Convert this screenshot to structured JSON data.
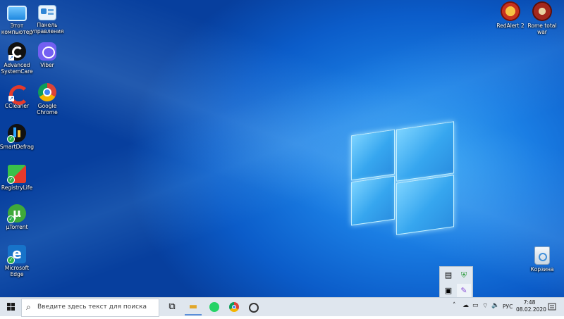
{
  "desktop": {
    "icons_left": [
      {
        "name": "this-pc",
        "label": "Этот\nкомпьютер",
        "icon": "monitor-icon"
      },
      {
        "name": "control-panel",
        "label": "Панель\nуправления",
        "icon": "control-panel-icon"
      },
      {
        "name": "advanced-systemcare",
        "label": "Advanced\nSystemCare",
        "icon": "systemcare-icon"
      },
      {
        "name": "viber",
        "label": "Viber",
        "icon": "viber-icon"
      },
      {
        "name": "ccleaner",
        "label": "CCleaner",
        "icon": "ccleaner-icon"
      },
      {
        "name": "google-chrome",
        "label": "Google\nChrome",
        "icon": "chrome-icon"
      },
      {
        "name": "smartdefrag",
        "label": "SmartDefrag",
        "icon": "smartdefrag-icon"
      },
      {
        "name": "registrylife",
        "label": "RegistryLife",
        "icon": "registrylife-icon"
      },
      {
        "name": "utorrent",
        "label": "µTorrent",
        "icon": "utorrent-icon"
      },
      {
        "name": "microsoft-edge",
        "label": "Microsoft\nEdge",
        "icon": "edge-icon"
      }
    ],
    "icons_right": [
      {
        "name": "redalert2",
        "label": "RedAlert 2",
        "icon": "redalert-icon"
      },
      {
        "name": "rome-total-war",
        "label": "Rome total\nwar",
        "icon": "rome-icon"
      },
      {
        "name": "recycle-bin",
        "label": "Корзина",
        "icon": "recycle-bin-icon"
      }
    ]
  },
  "taskbar": {
    "search_placeholder": "Введите здесь текст для поиска",
    "pinned": [
      "task-view-icon",
      "file-explorer-icon",
      "whatsapp-icon",
      "chrome-icon",
      "media-icon"
    ],
    "tray": {
      "language": "РУС",
      "time": "7:48",
      "date": "08.02.2020"
    }
  },
  "colors": {
    "desktop_blue": "#0b5cc9",
    "taskbar": "#dfe6ee",
    "accent": "#0078d7"
  }
}
